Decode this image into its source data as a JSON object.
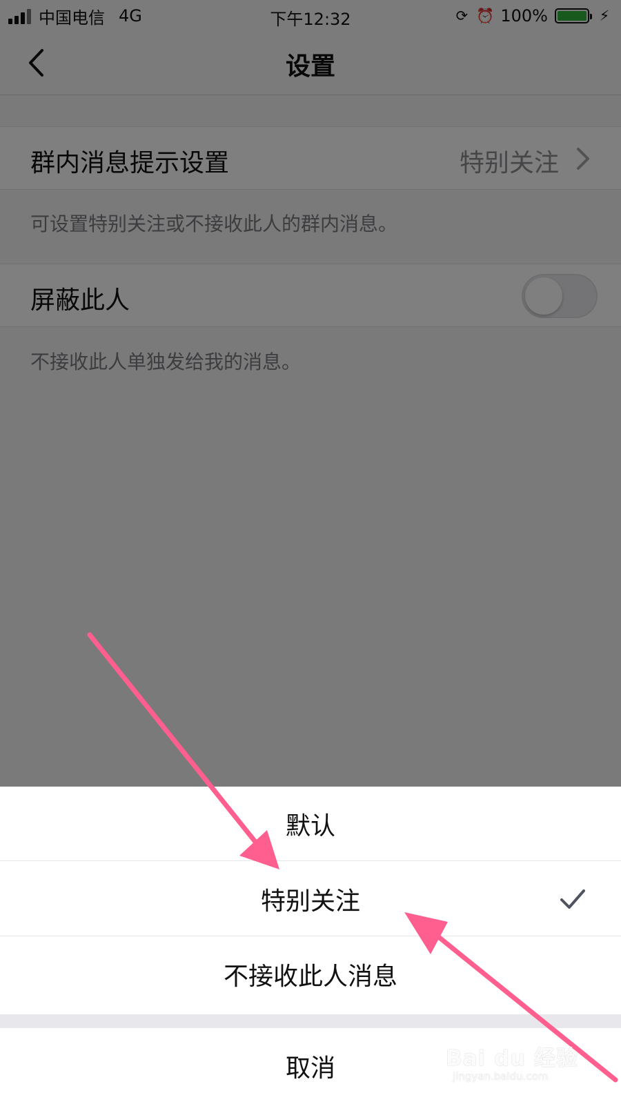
{
  "status_bar": {
    "carrier": "中国电信",
    "network": "4G",
    "time": "下午12:32",
    "battery": "100%",
    "battery_color": "#31b33c",
    "icons": [
      "signal-icon",
      "rotation-lock-icon",
      "alarm-icon",
      "battery-icon",
      "charging-icon"
    ]
  },
  "header": {
    "title": "设置",
    "back_icon": "chevron-left-icon"
  },
  "settings": {
    "group_message": {
      "label": "群内消息提示设置",
      "value": "特别关注",
      "helper": "可设置特别关注或不接收此人的群内消息。",
      "icon": "chevron-right-icon"
    },
    "block_person": {
      "label": "屏蔽此人",
      "helper": "不接收此人单独发给我的消息。",
      "enabled": false
    }
  },
  "sheet": {
    "options": [
      {
        "label": "默认",
        "selected": false
      },
      {
        "label": "特别关注",
        "selected": true
      },
      {
        "label": "不接收此人消息",
        "selected": false
      }
    ],
    "cancel": "取消",
    "check_icon": "checkmark-icon"
  },
  "annotation": {
    "arrow_color": "#ff5f8f"
  },
  "watermark": {
    "main": "Bai du 经验",
    "sub": "jingyan.baidu.com"
  }
}
